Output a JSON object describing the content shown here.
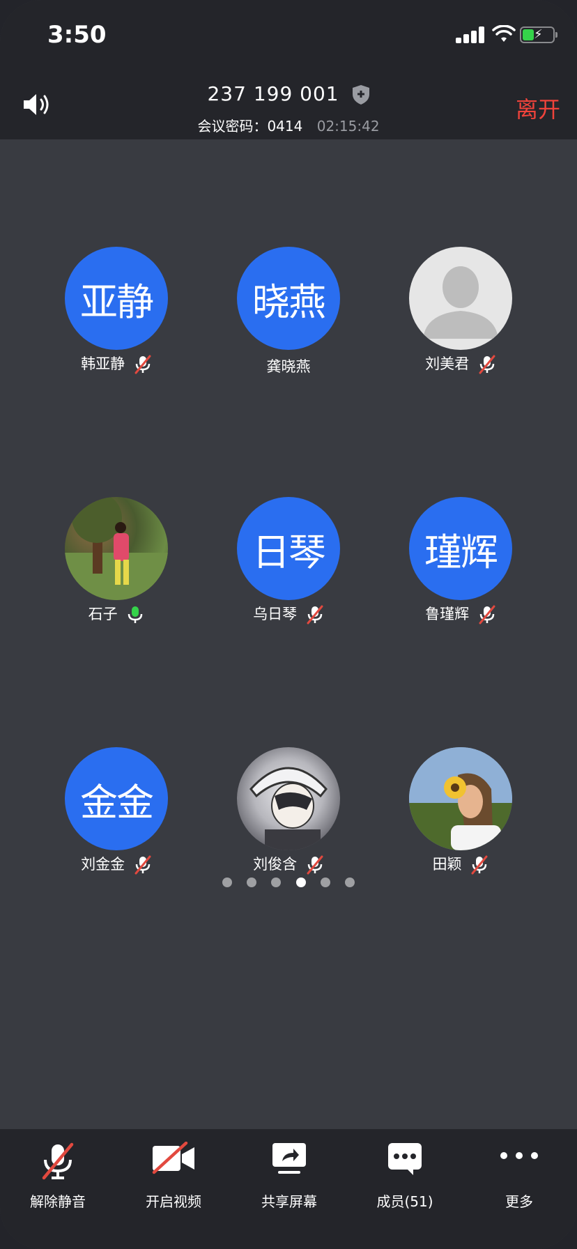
{
  "status_bar": {
    "time": "3:50"
  },
  "header": {
    "meeting_id": "237 199 001",
    "password_label": "会议密码：0414",
    "elapsed": "02:15:42",
    "leave_label": "离开"
  },
  "participants": [
    {
      "name": "韩亚静",
      "avatar_text": "亚静",
      "avatar": "blue",
      "mic": "muted"
    },
    {
      "name": "龚晓燕",
      "avatar_text": "晓燕",
      "avatar": "blue",
      "mic": "none"
    },
    {
      "name": "刘美君",
      "avatar_text": "",
      "avatar": "default-user-icon",
      "mic": "muted"
    },
    {
      "name": "石子",
      "avatar_text": "",
      "avatar": "photo",
      "mic": "active"
    },
    {
      "name": "乌日琴",
      "avatar_text": "日琴",
      "avatar": "blue",
      "mic": "muted"
    },
    {
      "name": "鲁瑾辉",
      "avatar_text": "瑾辉",
      "avatar": "blue",
      "mic": "muted"
    },
    {
      "name": "刘金金",
      "avatar_text": "金金",
      "avatar": "blue",
      "mic": "muted"
    },
    {
      "name": "刘俊含",
      "avatar_text": "",
      "avatar": "photo",
      "mic": "muted"
    },
    {
      "name": "田颖",
      "avatar_text": "",
      "avatar": "photo",
      "mic": "muted"
    }
  ],
  "pager": {
    "pages": 6,
    "current": 4
  },
  "toolbar": {
    "unmute": "解除静音",
    "start_video": "开启视频",
    "share_screen": "共享屏幕",
    "members": "成员(51)",
    "more": "更多"
  },
  "colors": {
    "avatar_blue": "#2a6ef0",
    "leave_red": "#f0433b",
    "mic_active_green": "#35d34a",
    "mute_slash_red": "#e2493f"
  }
}
